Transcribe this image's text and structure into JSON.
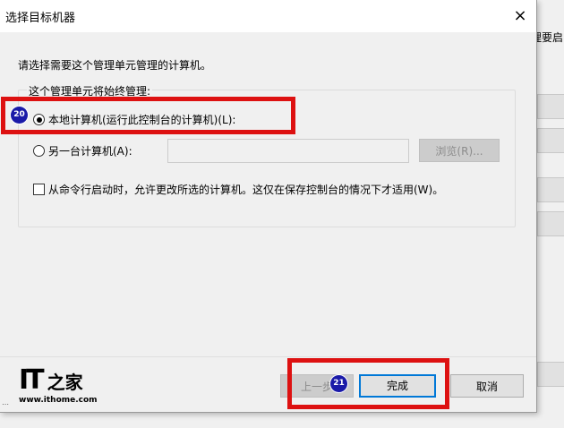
{
  "background": {
    "partial_text": "理要启"
  },
  "dialog": {
    "title": "选择目标机器",
    "close_glyph": "×",
    "prompt": "请选择需要这个管理单元管理的计算机。",
    "group_label": "这个管理单元将始终管理:",
    "option_local": "本地计算机(运行此控制台的计算机)(L):",
    "option_other": "另一台计算机(A):",
    "other_computer_value": "",
    "browse_button": "浏览(R)...",
    "allow_change_label": "从命令行启动时，允许更改所选的计算机。这仅在保存控制台的情况下才适用(W)。",
    "back_button": "上一步",
    "finish_button": "完成",
    "cancel_button": "取消"
  },
  "annotations": {
    "step_local": "20",
    "step_finish": "21",
    "highlight_color": "#dd1111",
    "badge_color": "#1a1aa8"
  },
  "watermark": {
    "logo_it": "IT",
    "logo_home": "之家",
    "url": "www.ithome.com"
  }
}
